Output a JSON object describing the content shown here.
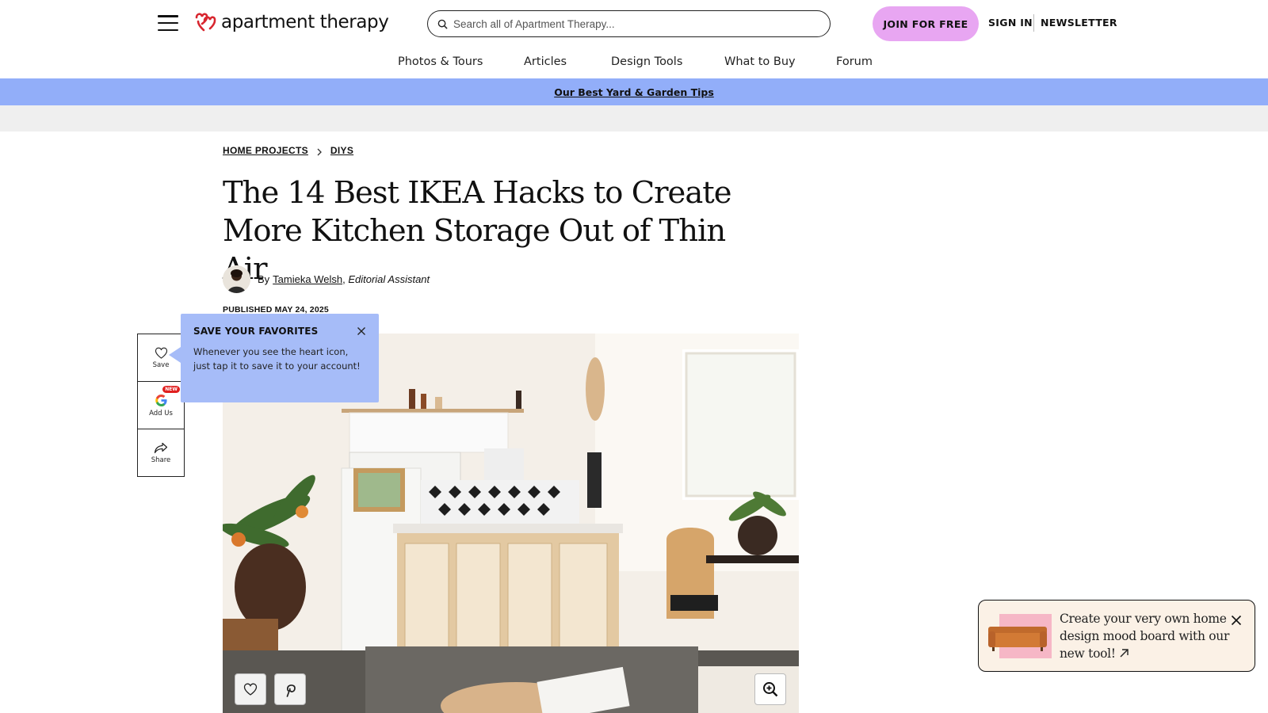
{
  "header": {
    "logo_text": "apartment therapy",
    "search_placeholder": "Search all of Apartment Therapy...",
    "join_label": "JOIN FOR FREE",
    "signin_label": "SIGN IN",
    "newsletter_label": "NEWSLETTER",
    "brand_color": "#d8262f",
    "join_color": "#e8a6f2"
  },
  "nav": {
    "items": [
      {
        "label": "Photos & Tours"
      },
      {
        "label": "Articles"
      },
      {
        "label": "Design Tools"
      },
      {
        "label": "What to Buy"
      },
      {
        "label": "Forum"
      }
    ]
  },
  "promo": {
    "label": "Our Best Yard & Garden Tips",
    "color": "#92aef9"
  },
  "breadcrumb": {
    "items": [
      {
        "label": "HOME PROJECTS"
      },
      {
        "label": "DIYS"
      }
    ]
  },
  "article": {
    "title": "The 14 Best IKEA Hacks to Create More Kitchen Storage Out of Thin Air",
    "byline_prefix": "By",
    "author": "Tamieka Welsh",
    "author_role": "Editorial Assistant",
    "published": "PUBLISHED MAY 24, 2025"
  },
  "rail": {
    "save_label": "Save",
    "addus_label": "Add Us",
    "new_badge": "NEW",
    "share_label": "Share"
  },
  "tooltip": {
    "title": "SAVE YOUR FAVORITES",
    "body": "Whenever you see the heart icon, just tap it to save it to your account!",
    "color": "#a6bcf8"
  },
  "mood_board": {
    "text": "Create your very own home design mood board with our new tool!"
  },
  "icons": {
    "menu": "hamburger-icon",
    "search": "search-icon",
    "heart": "heart-icon",
    "google": "google-icon",
    "share": "share-icon",
    "pinterest": "pinterest-icon",
    "zoom": "zoom-in-icon",
    "close": "close-icon",
    "arrow": "arrow-up-right-icon"
  }
}
